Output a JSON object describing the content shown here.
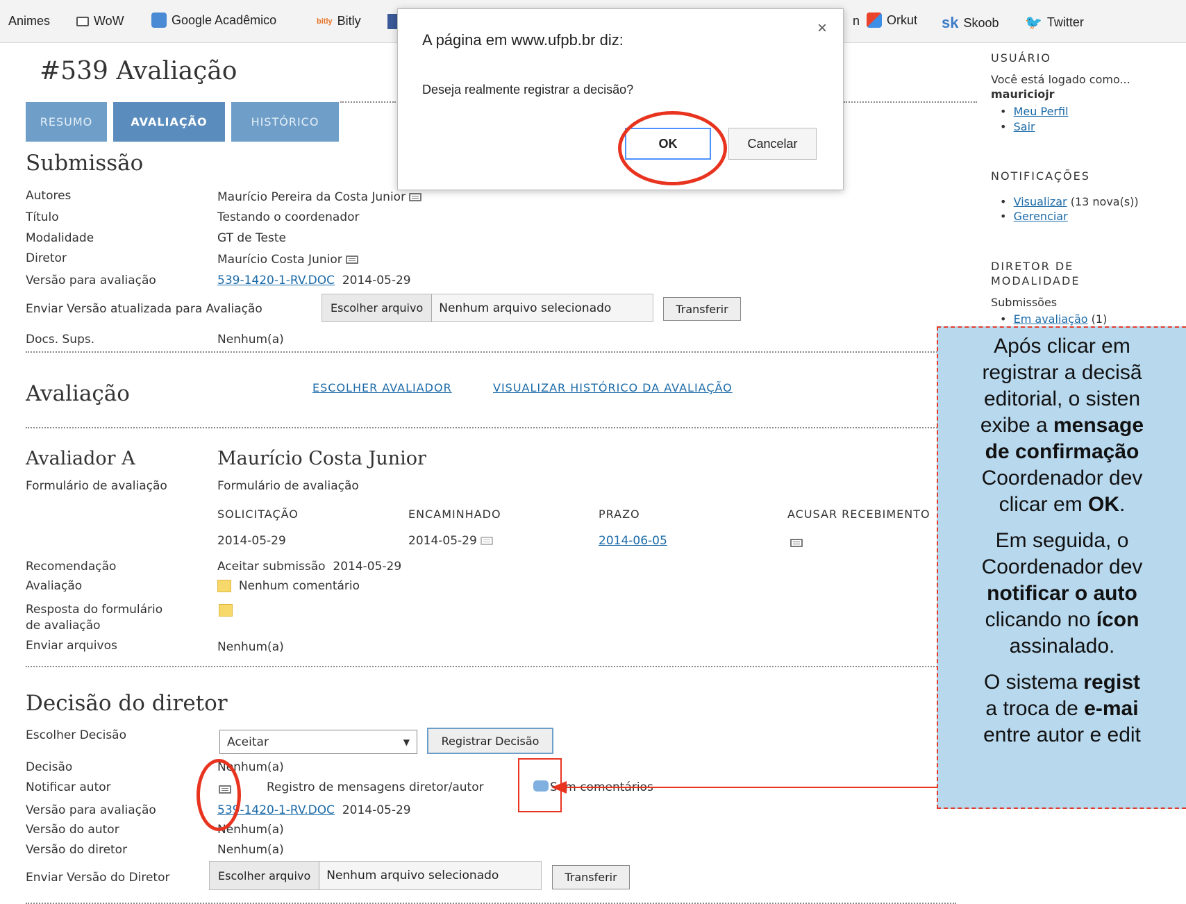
{
  "bookmarks": [
    "Animes",
    "WoW",
    "Google Acadêmico",
    "Bitly",
    "Orkut",
    "Skoob",
    "Twitter"
  ],
  "bookmark_partial": "n",
  "page_title": "#539 Avaliação",
  "tabs": [
    "RESUMO",
    "AVALIAÇÃO",
    "HISTÓRICO"
  ],
  "submission": {
    "heading": "Submissão",
    "rows": [
      {
        "label": "Autores",
        "value": "Maurício Pereira da Costa Junior"
      },
      {
        "label": "Título",
        "value": "Testando o coordenador"
      },
      {
        "label": "Modalidade",
        "value": "GT de Teste"
      },
      {
        "label": "Diretor",
        "value": "Maurício Costa Junior"
      },
      {
        "label": "Versão para avaliação",
        "value": "539-1420-1-RV.DOC",
        "date": "2014-05-29"
      }
    ],
    "upload_label": "Enviar Versão atualizada para Avaliação",
    "choose_file": "Escolher arquivo",
    "no_file": "Nenhum arquivo selecionado",
    "transfer": "Transferir",
    "docs_label": "Docs. Sups.",
    "docs_value": "Nenhum(a)"
  },
  "evaluation": {
    "heading": "Avaliação",
    "links": [
      "ESCOLHER AVALIADOR",
      "VISUALIZAR HISTÓRICO DA AVALIAÇÃO"
    ],
    "reviewer_label": "Avaliador A",
    "reviewer_name": "Maurício Costa Junior",
    "form_label": "Formulário de avaliação",
    "form_value": "Formulário de avaliação",
    "cols": [
      "SOLICITAÇÃO",
      "ENCAMINHADO",
      "PRAZO",
      "ACUSAR RECEBIMENTO"
    ],
    "dates": [
      "2014-05-29",
      "2014-05-29",
      "2014-06-05"
    ],
    "recommendation_label": "Recomendação",
    "recommendation_value": "Aceitar submissão",
    "recommendation_date": "2014-05-29",
    "review_label": "Avaliação",
    "review_value": "Nenhum comentário",
    "response_label_1": "Resposta do formulário",
    "response_label_2": "de avaliação",
    "send_files_label": "Enviar arquivos",
    "send_files_value": "Nenhum(a)"
  },
  "decision": {
    "heading": "Decisão do diretor",
    "choose_label": "Escolher Decisão",
    "select_value": "Aceitar",
    "register_button": "Registrar Decisão",
    "decision_label": "Decisão",
    "decision_value": "Nenhum(a)",
    "notify_label": "Notificar autor",
    "log_text": "Registro de mensagens diretor/autor",
    "no_comments": "Sem comentários",
    "version_label": "Versão para avaliação",
    "version_file": "539-1420-1-RV.DOC",
    "version_date": "2014-05-29",
    "author_version_label": "Versão do autor",
    "author_version_value": "Nenhum(a)",
    "director_version_label": "Versão do diretor",
    "director_version_value": "Nenhum(a)",
    "send_label": "Enviar Versão do Diretor",
    "choose_file": "Escolher arquivo",
    "no_file": "Nenhum arquivo selecionado",
    "transfer": "Transferir"
  },
  "sidebar": {
    "user_heading": "USUÁRIO",
    "logged_as": "Você está logado como...",
    "username": "mauriciojr",
    "user_links": [
      "Meu Perfil",
      "Sair"
    ],
    "notif_heading": "NOTIFICAÇÕES",
    "notif_view": "Visualizar",
    "notif_count": "(13 nova(s))",
    "notif_manage": "Gerenciar",
    "director_heading_1": "DIRETOR DE",
    "director_heading_2": "MODALIDADE",
    "submissions": "Submissões",
    "in_review": "Em avaliação",
    "in_review_count": "(1)"
  },
  "dialog": {
    "title": "A página em www.ufpb.br diz:",
    "message": "Deseja realmente registrar a decisão?",
    "ok": "OK",
    "cancel": "Cancelar",
    "close": "×"
  },
  "callout": {
    "p1": [
      "Após clicar em",
      "registrar a decisã",
      "editorial, o sisten",
      "exibe a ",
      "mensage",
      "de confirmação",
      "Coordenador dev",
      "clicar em ",
      "OK",
      "."
    ],
    "p2": [
      "Em seguida, o",
      "Coordenador dev",
      "notificar o auto",
      "clicando no ",
      "ícon",
      "assinalado."
    ],
    "p3": [
      "O sistema ",
      "regist",
      "a troca de ",
      "e-mai",
      "entre autor e edit"
    ]
  },
  "colors": {
    "tab": "#6f9fc9",
    "link": "#1a6aa8",
    "callout_bg": "#b8d8ee",
    "annotation": "#e8331f"
  }
}
